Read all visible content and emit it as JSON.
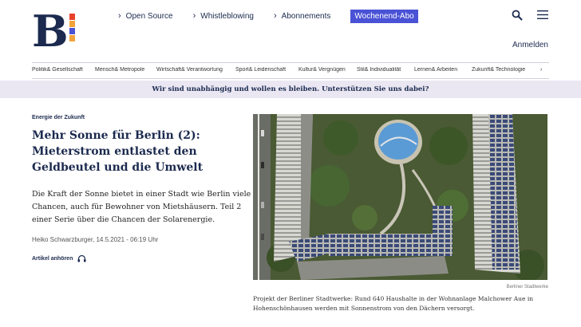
{
  "header": {
    "logo_letter": "B",
    "logo_stripes": [
      "#e8412c",
      "#f2a33a",
      "#4a52d6",
      "#f2a33a"
    ],
    "nav": [
      {
        "label": "Open Source"
      },
      {
        "label": "Whistleblowing"
      },
      {
        "label": "Abonnements"
      }
    ],
    "cta_label": "Wochenend-Abo",
    "login_label": "Anmelden",
    "icons": [
      "search-icon",
      "menu-icon"
    ]
  },
  "categories": [
    "Politik& Gesellschaft",
    "Mensch& Metropole",
    "Wirtschaft& Verantwortung",
    "Sport& Leidenschaft",
    "Kultur& Vergnügen",
    "Stil& Individualität",
    "Lernen& Arbeiten",
    "Zukunft& Technologie"
  ],
  "banner": {
    "text": "Wir sind unabhängig und wollen es bleiben. Unterstützen Sie uns dabei?"
  },
  "article": {
    "kicker": "Energie der Zukunft",
    "headline": "Mehr Sonne für Berlin (2): Mieterstrom entlastet den Geldbeutel und die Umwelt",
    "lead": "Die Kraft der Sonne bietet in einer Stadt wie Berlin viele Chancen, auch für Bewohner von Mietshäusern. Teil 2 einer Serie über die Chancen der Solarenergie.",
    "meta": "Heiko Schwarzburger, 14.5.2021 - 06:19 Uhr",
    "listen_label": "Artikel anhören",
    "photo_credit": "Berliner Stadtwerke",
    "caption": "Projekt der Berliner Stadtwerke: Rund 640 Haushalte in der Wohnanlage Malchower Aue in Hohenschönhausen werden mit Sonnenstrom von den Dächern versorgt."
  },
  "colors": {
    "brand": "#1b2a4e",
    "accent": "#4a52d6",
    "banner_bg": "#eae7f3"
  }
}
